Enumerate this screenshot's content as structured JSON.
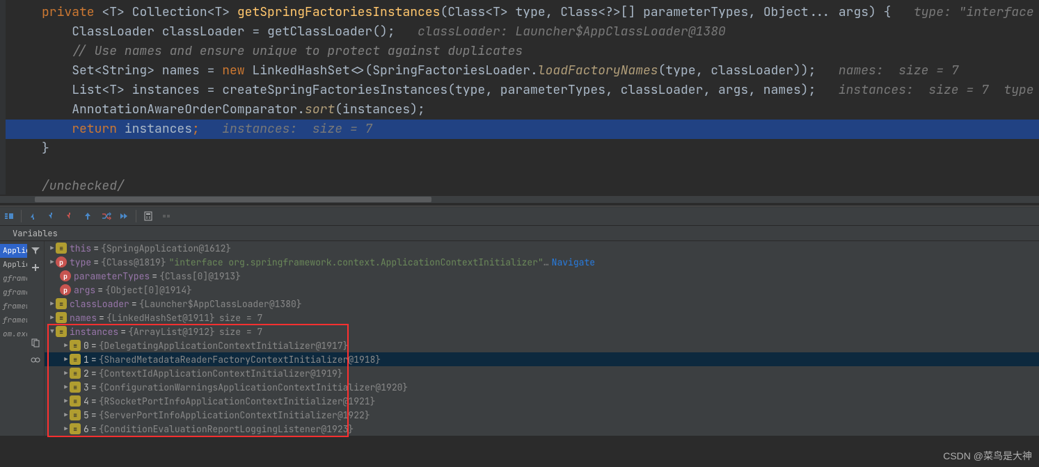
{
  "editor": {
    "lines": {
      "l1_private": "private",
      "l1_t": "<T>",
      "l1_coll": "Collection<T>",
      "l1_method": "getSpringFactoriesInstances",
      "l1_params": "(Class<T> type, Class<?>[] parameterTypes, Object... args) {",
      "l1_hint": "type: \"interface",
      "l2_pre": "ClassLoader classLoader = ",
      "l2_call": "getClassLoader",
      "l2_post": "();",
      "l2_hint": "classLoader: Launcher$AppClassLoader@1380",
      "l3": "// Use names and ensure unique to protect against duplicates",
      "l4_pre": "Set<String> names = ",
      "l4_new": "new",
      "l4_mid": " LinkedHashSet<>(SpringFactoriesLoader.",
      "l4_call": "loadFactoryNames",
      "l4_post": "(type, classLoader));",
      "l4_hint": "names:  size = 7",
      "l5_pre": "List<T> instances = ",
      "l5_call": "createSpringFactoriesInstances",
      "l5_post": "(type, parameterTypes, classLoader, args, names);",
      "l5_hint": "instances:  size = 7  type",
      "l6_pre": "AnnotationAwareOrderComparator.",
      "l6_call": "sort",
      "l6_post": "(instances);",
      "l7_ret": "return",
      "l7_var": " instances",
      "l7_semi": ";",
      "l7_hint": "instances:  size = 7",
      "l8": "}",
      "l9": "/unchecked/"
    }
  },
  "tabs": {
    "variables": "Variables"
  },
  "frames": {
    "items": [
      {
        "label": "Applic"
      },
      {
        "label": "Applic"
      },
      {
        "label": "gframe"
      },
      {
        "label": "gframe"
      },
      {
        "label": "framew"
      },
      {
        "label": "framew"
      },
      {
        "label": "om.exa"
      }
    ]
  },
  "vars": {
    "this": {
      "name": "this",
      "val": "{SpringApplication@1612}"
    },
    "type": {
      "name": "type",
      "val": "{Class@1819}",
      "str": "\"interface org.springframework.context.ApplicationContextInitializer\"",
      "nav": "Navigate"
    },
    "parameterTypes": {
      "name": "parameterTypes",
      "val": "{Class[0]@1913}"
    },
    "args": {
      "name": "args",
      "val": "{Object[0]@1914}"
    },
    "classLoader": {
      "name": "classLoader",
      "val": "{Launcher$AppClassLoader@1380}"
    },
    "names": {
      "name": "names",
      "val": "{LinkedHashSet@1911}",
      "extra": "size = 7"
    },
    "instances": {
      "name": "instances",
      "val": "{ArrayList@1912}",
      "extra": "size = 7"
    },
    "items": [
      {
        "idx": "0",
        "val": "{DelegatingApplicationContextInitializer@1917}"
      },
      {
        "idx": "1",
        "val": "{SharedMetadataReaderFactoryContextInitializer@1918}"
      },
      {
        "idx": "2",
        "val": "{ContextIdApplicationContextInitializer@1919}"
      },
      {
        "idx": "3",
        "val": "{ConfigurationWarningsApplicationContextInitializer@1920}"
      },
      {
        "idx": "4",
        "val": "{RSocketPortInfoApplicationContextInitializer@1921}"
      },
      {
        "idx": "5",
        "val": "{ServerPortInfoApplicationContextInitializer@1922}"
      },
      {
        "idx": "6",
        "val": "{ConditionEvaluationReportLoggingListener@1923}"
      }
    ]
  },
  "watermark": "CSDN @菜鸟是大神"
}
